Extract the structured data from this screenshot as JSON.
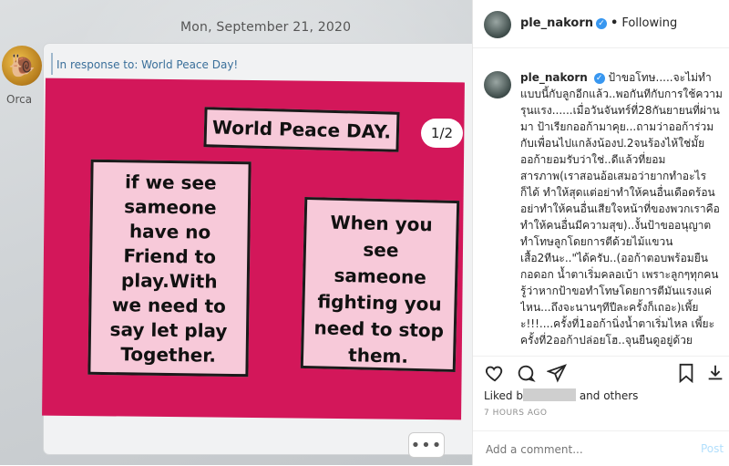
{
  "photo": {
    "date": "Mon, September 21, 2020",
    "sender": {
      "name": "Orca",
      "avatar_icon": "snail-icon"
    },
    "reply_to": "In response to: World Peace Day!",
    "slide": {
      "title": "World Peace DAY.",
      "page": "1/2",
      "left_card": "if we see\nsameone\nhave no\nFriend to\nplay.With\nwe need to\nsay let play\nTogether.",
      "right_card": "When you\nsee\nsameone\nfighting you\nneed to stop\nthem."
    },
    "more_label": "•••"
  },
  "header": {
    "username": "ple_nakorn",
    "verified_mark": "✓",
    "separator": "•",
    "follow_status": "Following"
  },
  "caption": {
    "username": "ple_nakorn",
    "text": "ป้าขอโทษ.....จะไม่ทำแบบนี้กับลูกอีกแล้ว..พอกันทีกับการใช้ความรุนแรง......เมื่อวันจันทร์ที่28กันยายนที่ผ่านมา ป้าเรียกออก้ามาคุย...ถามว่าออก้าร่วมกับเพื่อนไปแกล้งน้องป.2จนร้องไห้ใช่มั้ย ออก้ายอมรับว่าใช่..ดีแล้วที่ยอมสารภาพ(เราสอนอ้อเสมอว่ายากทำอะไรก็ได้ ทำให้สุดแต่อย่าทำให้คนอื่นเดือดร้อนอย่าทำให้คนอื่นเสียใจหน้าที่ของพวกเราคือทำให้คนอื่นมีความสุข)..งั้นป้าขออนุญาตทำโทษลูกโดยการตีด้วยไม้แขวนเสื้อ2ทีนะ..\"ได้ครับ..(ออก้าตอบพร้อมยืนกอดอก น้ำตาเริ่มคลอเบ้า เพราะลูกๆทุกคนรู้ว่าหากป้าขอทำโทษโดยการตีมันแรงแค่ไหน...ถึงจะนานๆทีปีละครั้งก็เถอะ)เพี้ยะ!!!....ครั้งที่1ออก้านิ่งน้ำตาเริ่มไหล เพี้ยะครั้งที่2ออก้าปล่อยโฮ..จุนยืนดูอยู่ด้วยร้องไห้ตามลูก....ป้าวางไม้แขวนเสื้อแล้วเดินไปร้องไห้อีกห้องนึง\nวันต่อมาผู้ปกครองโรงเรียนออก้าได้ส่ง"
  },
  "engagement": {
    "liked_prefix": "Liked b",
    "liked_suffix": "and others",
    "time_ago": "7 HOURS AGO"
  },
  "comment": {
    "placeholder": "Add a comment...",
    "post_label": "Post"
  },
  "colors": {
    "slide_pink": "#d3175a",
    "card_pink": "#f7c9d9",
    "verified_blue": "#3897f0"
  }
}
